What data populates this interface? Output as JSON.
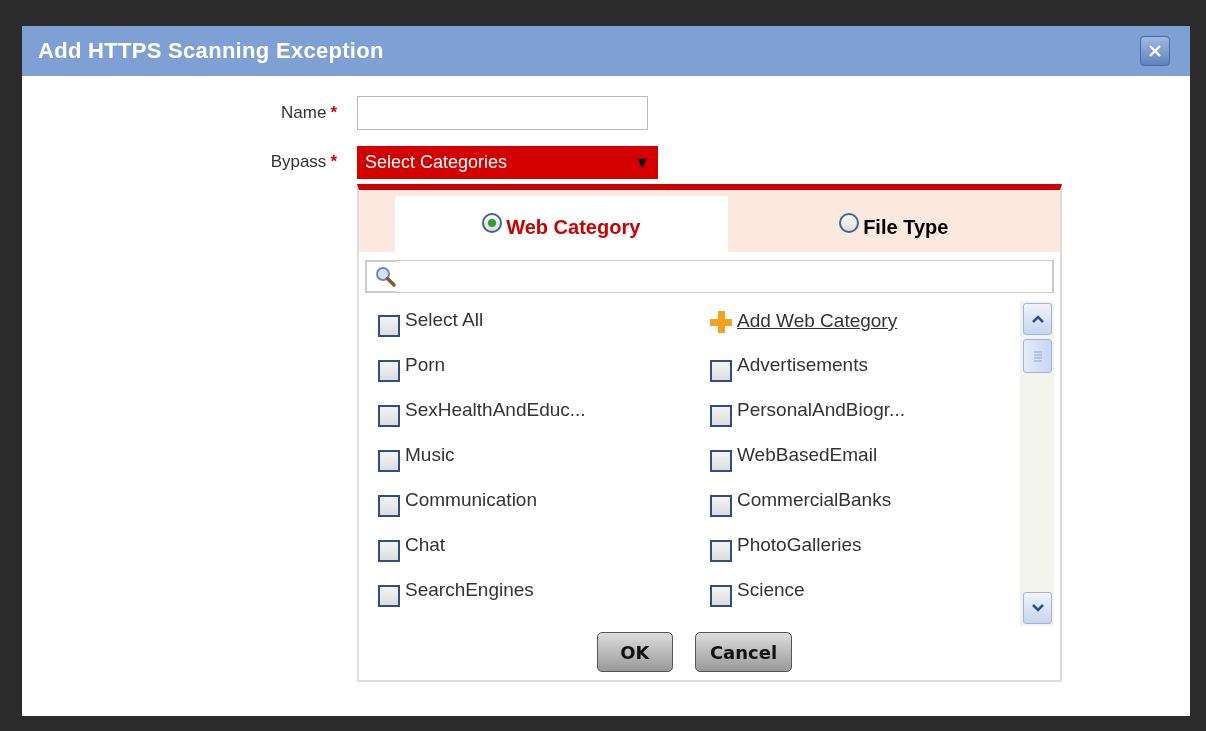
{
  "dialog": {
    "title": "Add HTTPS Scanning Exception"
  },
  "fields": [
    {
      "label": "Name",
      "required_mark": "*",
      "kind": "text"
    },
    {
      "label": "Bypass",
      "required_mark": "*",
      "kind": "dropdown",
      "value": "Select Categories",
      "arrow": "▼"
    }
  ],
  "tabs": [
    {
      "label": "Web Category",
      "selected": true
    },
    {
      "label": "File Type",
      "selected": false
    }
  ],
  "select_all": {
    "label": "Select All",
    "checked": false
  },
  "add_link": {
    "label": "Add Web Category"
  },
  "categories": [
    {
      "label": "Porn",
      "checked": false
    },
    {
      "label": "Advertisements",
      "checked": false
    },
    {
      "label": "SexHealthAndEduc...",
      "checked": false
    },
    {
      "label": "PersonalAndBiogr...",
      "checked": false
    },
    {
      "label": "Music",
      "checked": false
    },
    {
      "label": "WebBasedEmail",
      "checked": false
    },
    {
      "label": "Communication",
      "checked": false
    },
    {
      "label": "CommercialBanks",
      "checked": false
    },
    {
      "label": "Chat",
      "checked": false
    },
    {
      "label": "PhotoGalleries",
      "checked": false
    },
    {
      "label": "SearchEngines",
      "checked": false
    },
    {
      "label": "Science",
      "checked": false
    }
  ],
  "buttons": [
    "OK",
    "Cancel"
  ]
}
